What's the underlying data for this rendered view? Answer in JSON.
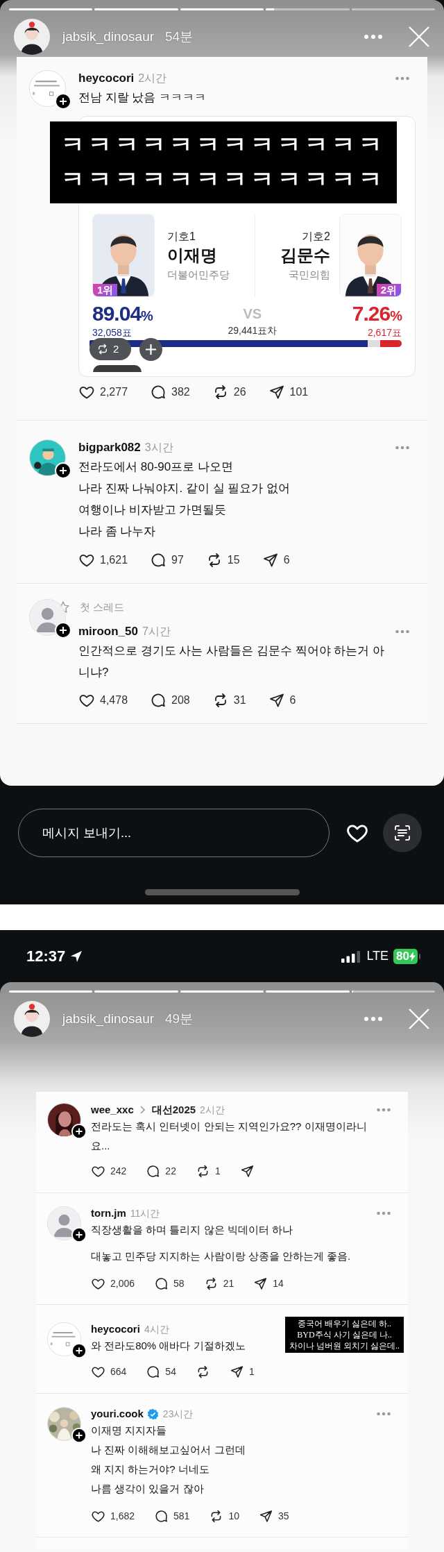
{
  "story_top": {
    "progress": [
      {
        "level": 1
      },
      {
        "level": 1
      },
      {
        "level": 1
      },
      {
        "level": 0.1
      },
      {
        "level": 0
      }
    ],
    "header": {
      "username": "jabsik_dinosaur",
      "time": "54분"
    },
    "posts": [
      {
        "username": "heycocori",
        "time": "2시간",
        "verified": false,
        "paragraphs": [
          "전남 지랄 났음 ㅋㅋㅋㅋ"
        ],
        "sticker": {
          "kind": "banner",
          "lines": [
            "ㅋㅋㅋㅋㅋㅋㅋㅋㅋㅋㅋㅋ",
            "ㅋㅋㅋㅋㅋㅋㅋㅋㅋㅋㅋㅋ"
          ]
        },
        "embed": {
          "candidates": [
            {
              "number": "기호1",
              "name": "이재명",
              "party": "더불어민주당",
              "rank": "1위",
              "percent": "89.04",
              "unit": "%",
              "votes": "32,058표",
              "color": "#1e2d84",
              "level": 0.89
            },
            {
              "number": "기호2",
              "name": "김문수",
              "party": "국민의힘",
              "rank": "2위",
              "percent": "7.26",
              "unit": "%",
              "votes": "2,617표",
              "color": "#d8262f",
              "level": 0.07
            }
          ],
          "vs": "VS",
          "margin": "29,441표차",
          "reposts": "2"
        },
        "likes": "2,277",
        "comments": "382",
        "reposts": "26",
        "shares": "101"
      },
      {
        "username": "bigpark082",
        "time": "3시간",
        "verified": false,
        "paragraphs": [
          "전라도에서 80-90프로 나오면\n나라 진짜 나눠야지. 같이 실 필요가 없어\n여행이나 비자받고 가면될듯\n나라 좀 나누자"
        ],
        "likes": "1,621",
        "comments": "97",
        "reposts": "15",
        "shares": "6"
      },
      {
        "thread_label": "첫 스레드",
        "username": "miroon_50",
        "time": "7시간",
        "verified": false,
        "paragraphs": [
          "인간적으로 경기도 사는 사람들은 김문수 찍어야 하는거 아니냐?"
        ],
        "likes": "4,478",
        "comments": "208",
        "reposts": "31",
        "shares": "6"
      }
    ]
  },
  "reply_bar": {
    "placeholder": "메시지 보내기..."
  },
  "status_bar": {
    "time": "12:37",
    "network": "LTE",
    "battery": "80"
  },
  "story_bottom": {
    "progress": [
      {
        "level": 1
      },
      {
        "level": 1
      },
      {
        "level": 1
      },
      {
        "level": 1
      },
      {
        "level": 0.02
      }
    ],
    "header": {
      "username": "jabsik_dinosaur",
      "time": "49분"
    },
    "posts": [
      {
        "username": "wee_xxc",
        "topic": "대선2025",
        "time": "2시간",
        "verified": false,
        "paragraphs": [
          "전라도는 혹시 인터넷이 안되는 지역인가요?? 이재명이라니요..."
        ],
        "likes": "242",
        "comments": "22",
        "reposts": "1"
      },
      {
        "username": "torn.jm",
        "time": "11시간",
        "verified": false,
        "paragraphs": [
          "직장생활을 하며 틀리지 않은 빅데이터 하나",
          "대놓고 민주당 지지하는 사람이랑 상종을 안하는게 좋음."
        ],
        "likes": "2,006",
        "comments": "58",
        "reposts": "21",
        "shares": "14"
      },
      {
        "username": "heycocori",
        "time": "4시간",
        "verified": false,
        "paragraphs": [
          "와 전라도80% 애바다 기절하겠노"
        ],
        "sticker": {
          "kind": "caption",
          "lines": [
            "중국어 배우기 싫은데 하..",
            "BYD주식 사기 싫은데 나..",
            "차이나 넘버원 외치기 싫은데.."
          ]
        },
        "likes": "664",
        "comments": "54",
        "shares": "1"
      },
      {
        "username": "youri.cook",
        "time": "23시간",
        "verified": true,
        "paragraphs": [
          "이재명 지지자들\n나 진짜 이해해보고싶어서 그런데\n왜 지지 하는거야? 너네도\n 나름 생각이 있을거 잖아"
        ],
        "likes": "1,682",
        "comments": "581",
        "reposts": "10",
        "shares": "35"
      }
    ]
  }
}
